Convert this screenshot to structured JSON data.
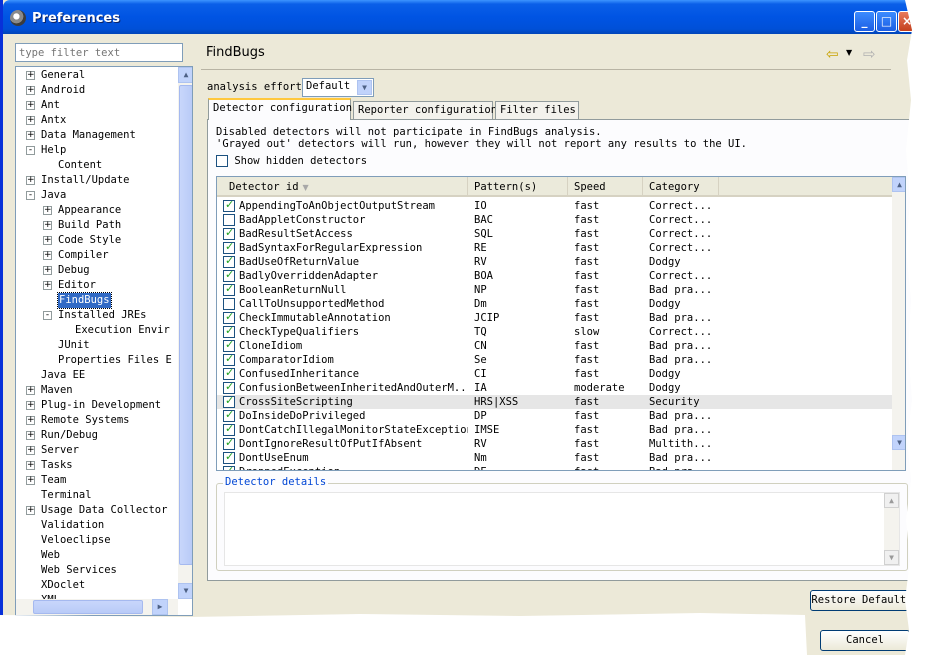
{
  "window": {
    "title": "Preferences",
    "min_icon": "minimize-icon",
    "max_icon": "maximize-icon",
    "close_icon": "close-icon"
  },
  "filter": {
    "placeholder": "type filter text"
  },
  "tree": {
    "items": [
      {
        "label": "General",
        "level": 0,
        "toggle": "+"
      },
      {
        "label": "Android",
        "level": 0,
        "toggle": "+"
      },
      {
        "label": "Ant",
        "level": 0,
        "toggle": "+"
      },
      {
        "label": "Antx",
        "level": 0,
        "toggle": "+"
      },
      {
        "label": "Data Management",
        "level": 0,
        "toggle": "+"
      },
      {
        "label": "Help",
        "level": 0,
        "toggle": "-"
      },
      {
        "label": "Content",
        "level": 1,
        "toggle": ""
      },
      {
        "label": "Install/Update",
        "level": 0,
        "toggle": "+"
      },
      {
        "label": "Java",
        "level": 0,
        "toggle": "-"
      },
      {
        "label": "Appearance",
        "level": 1,
        "toggle": "+"
      },
      {
        "label": "Build Path",
        "level": 1,
        "toggle": "+"
      },
      {
        "label": "Code Style",
        "level": 1,
        "toggle": "+"
      },
      {
        "label": "Compiler",
        "level": 1,
        "toggle": "+"
      },
      {
        "label": "Debug",
        "level": 1,
        "toggle": "+"
      },
      {
        "label": "Editor",
        "level": 1,
        "toggle": "+"
      },
      {
        "label": "FindBugs",
        "level": 1,
        "toggle": "",
        "selected": true
      },
      {
        "label": "Installed JREs",
        "level": 1,
        "toggle": "-"
      },
      {
        "label": "Execution Envir",
        "level": 2,
        "toggle": ""
      },
      {
        "label": "JUnit",
        "level": 1,
        "toggle": ""
      },
      {
        "label": "Properties Files E",
        "level": 1,
        "toggle": ""
      },
      {
        "label": "Java EE",
        "level": 0,
        "toggle": ""
      },
      {
        "label": "Maven",
        "level": 0,
        "toggle": "+"
      },
      {
        "label": "Plug-in Development",
        "level": 0,
        "toggle": "+"
      },
      {
        "label": "Remote Systems",
        "level": 0,
        "toggle": "+"
      },
      {
        "label": "Run/Debug",
        "level": 0,
        "toggle": "+"
      },
      {
        "label": "Server",
        "level": 0,
        "toggle": "+"
      },
      {
        "label": "Tasks",
        "level": 0,
        "toggle": "+"
      },
      {
        "label": "Team",
        "level": 0,
        "toggle": "+"
      },
      {
        "label": "Terminal",
        "level": 0,
        "toggle": ""
      },
      {
        "label": "Usage Data Collector",
        "level": 0,
        "toggle": "+"
      },
      {
        "label": "Validation",
        "level": 0,
        "toggle": ""
      },
      {
        "label": "Veloeclipse",
        "level": 0,
        "toggle": ""
      },
      {
        "label": "Web",
        "level": 0,
        "toggle": ""
      },
      {
        "label": "Web Services",
        "level": 0,
        "toggle": ""
      },
      {
        "label": "XDoclet",
        "level": 0,
        "toggle": ""
      },
      {
        "label": "XML",
        "level": 0,
        "toggle": ""
      }
    ]
  },
  "page": {
    "title": "FindBugs",
    "nav_back_icon": "back-arrow-icon",
    "nav_forward_icon": "forward-arrow-icon",
    "effort_label": "analysis effort",
    "effort_value": "Default",
    "tabs": [
      "Detector configuration",
      "Reporter configuration",
      "Filter files"
    ],
    "info_line1": "Disabled detectors will not participate in FindBugs analysis.",
    "info_line2": "'Grayed out' detectors will run, however they will not report any results to the UI.",
    "show_hidden_label": "Show hidden detectors",
    "columns": [
      "Detector id",
      "Pattern(s)",
      "Speed",
      "Category"
    ],
    "rows": [
      {
        "id": "AppendingToAnObjectOutputStream",
        "pattern": "IO",
        "speed": "fast",
        "category": "Correct...",
        "checked": true
      },
      {
        "id": "BadAppletConstructor",
        "pattern": "BAC",
        "speed": "fast",
        "category": "Correct...",
        "checked": false
      },
      {
        "id": "BadResultSetAccess",
        "pattern": "SQL",
        "speed": "fast",
        "category": "Correct...",
        "checked": true
      },
      {
        "id": "BadSyntaxForRegularExpression",
        "pattern": "RE",
        "speed": "fast",
        "category": "Correct...",
        "checked": true
      },
      {
        "id": "BadUseOfReturnValue",
        "pattern": "RV",
        "speed": "fast",
        "category": "Dodgy",
        "checked": true
      },
      {
        "id": "BadlyOverriddenAdapter",
        "pattern": "BOA",
        "speed": "fast",
        "category": "Correct...",
        "checked": true
      },
      {
        "id": "BooleanReturnNull",
        "pattern": "NP",
        "speed": "fast",
        "category": "Bad pra...",
        "checked": true
      },
      {
        "id": "CallToUnsupportedMethod",
        "pattern": "Dm",
        "speed": "fast",
        "category": "Dodgy",
        "checked": false
      },
      {
        "id": "CheckImmutableAnnotation",
        "pattern": "JCIP",
        "speed": "fast",
        "category": "Bad pra...",
        "checked": true
      },
      {
        "id": "CheckTypeQualifiers",
        "pattern": "TQ",
        "speed": "slow",
        "category": "Correct...",
        "checked": true
      },
      {
        "id": "CloneIdiom",
        "pattern": "CN",
        "speed": "fast",
        "category": "Bad pra...",
        "checked": true
      },
      {
        "id": "ComparatorIdiom",
        "pattern": "Se",
        "speed": "fast",
        "category": "Bad pra...",
        "checked": true
      },
      {
        "id": "ConfusedInheritance",
        "pattern": "CI",
        "speed": "fast",
        "category": "Dodgy",
        "checked": true
      },
      {
        "id": "ConfusionBetweenInheritedAndOuterM...",
        "pattern": "IA",
        "speed": "moderate",
        "category": "Dodgy",
        "checked": true
      },
      {
        "id": "CrossSiteScripting",
        "pattern": "HRS|XSS",
        "speed": "fast",
        "category": "Security",
        "checked": true,
        "selected": true
      },
      {
        "id": "DoInsideDoPrivileged",
        "pattern": "DP",
        "speed": "fast",
        "category": "Bad pra...",
        "checked": true
      },
      {
        "id": "DontCatchIllegalMonitorStateException",
        "pattern": "IMSE",
        "speed": "fast",
        "category": "Bad pra...",
        "checked": true
      },
      {
        "id": "DontIgnoreResultOfPutIfAbsent",
        "pattern": "RV",
        "speed": "fast",
        "category": "Multith...",
        "checked": true
      },
      {
        "id": "DontUseEnum",
        "pattern": "Nm",
        "speed": "fast",
        "category": "Bad pra...",
        "checked": true
      },
      {
        "id": "DroppedException",
        "pattern": "DE",
        "speed": "fast",
        "category": "Bad pra...",
        "checked": true
      }
    ],
    "details_label": "Detector details",
    "restore_label": "Restore Defaults",
    "cancel_label": "Cancel"
  },
  "colors": {
    "titlebar": "#0054e3",
    "selection": "#316ac5",
    "tab_highlight": "#ffc83c",
    "details_label": "#0046d5"
  }
}
